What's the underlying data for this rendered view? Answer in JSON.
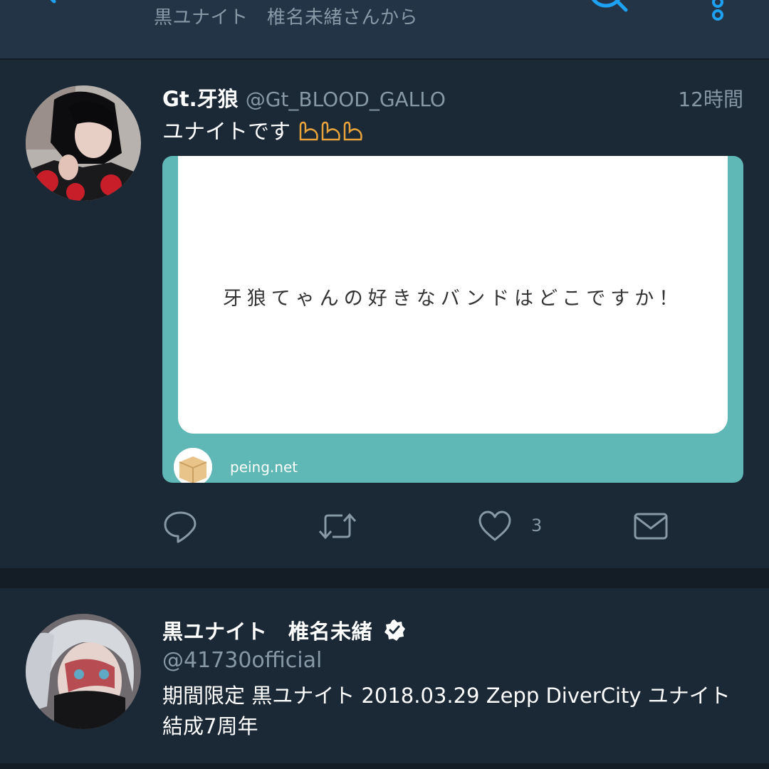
{
  "header": {
    "subtitle": "黒ユナイト　椎名未緒さんから",
    "back_icon": "back-arrow-icon",
    "search_icon": "search-icon",
    "more_icon": "more-vertical-icon"
  },
  "tweet": {
    "display_name": "Gt.牙狼",
    "handle": "@Gt_BLOOD_GALLO",
    "timestamp": "12時間",
    "text": "ユナイトです",
    "emoji": "💪💪💪",
    "media": {
      "question": "牙狼てゃんの好きなバンドはどこですか！",
      "site": "peing.net"
    },
    "actions": {
      "like_count": "3"
    }
  },
  "profile": {
    "display_name": "黒ユナイト　椎名未緒",
    "handle": "@41730official",
    "bio_line1": "期間限定 黒ユナイト 2018.03.29 Zepp DiverCity ユナイト",
    "bio_line2": "結成7周年"
  },
  "colors": {
    "background": "#1b2836",
    "header": "#243447",
    "accent": "#1da1f2",
    "muted": "#8899a6",
    "card_teal": "#5fb8b5"
  }
}
